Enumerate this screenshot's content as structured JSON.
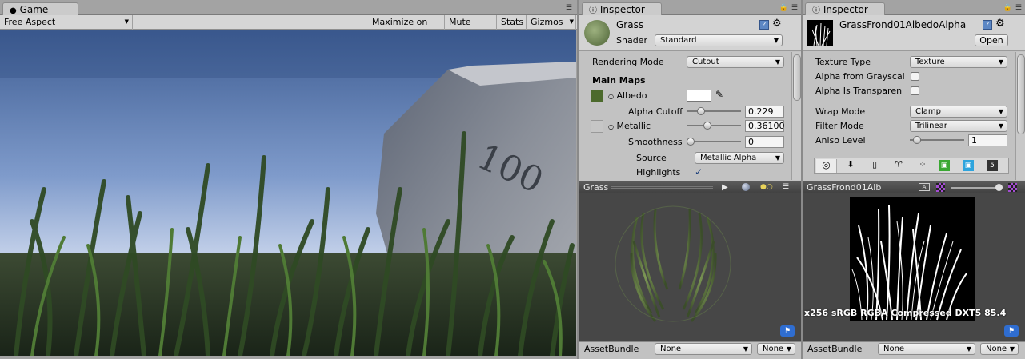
{
  "game": {
    "tab": "Game",
    "aspect": "Free Aspect",
    "buttons": [
      "Maximize on Play",
      "Mute audio",
      "Stats",
      "Gizmos"
    ],
    "scene_text": "100"
  },
  "inspector1": {
    "tab": "Inspector",
    "asset_name": "Grass",
    "shader_label": "Shader",
    "shader_value": "Standard",
    "rendering_mode_label": "Rendering Mode",
    "rendering_mode_value": "Cutout",
    "main_maps": "Main Maps",
    "albedo": "Albedo",
    "alpha_cutoff_label": "Alpha Cutoff",
    "alpha_cutoff_value": "0.229",
    "alpha_cutoff_fraction": 0.229,
    "metallic_label": "Metallic",
    "metallic_value": "0.36100",
    "metallic_fraction": 0.361,
    "smoothness_label": "Smoothness",
    "smoothness_value": "0",
    "smoothness_fraction": 0,
    "source_label": "Source",
    "source_value": "Metallic Alpha",
    "highlights_label": "Highlights",
    "highlights_checked": true,
    "preview_title": "Grass",
    "assetbundle_label": "AssetBundle",
    "assetbundle_value": "None",
    "assetbundle_variant": "None"
  },
  "inspector2": {
    "tab": "Inspector",
    "asset_name": "GrassFrond01AlbedoAlpha",
    "open_button": "Open",
    "texture_type_label": "Texture Type",
    "texture_type_value": "Texture",
    "alpha_from_grayscale_label": "Alpha from Grayscal",
    "alpha_is_transparency_label": "Alpha Is Transparen",
    "wrap_mode_label": "Wrap Mode",
    "wrap_mode_value": "Clamp",
    "filter_mode_label": "Filter Mode",
    "filter_mode_value": "Trilinear",
    "aniso_label": "Aniso Level",
    "aniso_value": "1",
    "aniso_fraction": 0.0625,
    "platform_icons": [
      "globe-icon",
      "download-icon",
      "phone-icon",
      "android-icon",
      "blackberry-icon",
      "windows-store-icon",
      "windows-phone-icon",
      "html5-icon"
    ],
    "preview_title": "GrassFrond01Alb",
    "preview_info": "x256 sRGB RGBA Compressed DXT5   85.4",
    "assetbundle_label": "AssetBundle",
    "assetbundle_value": "None",
    "assetbundle_variant": "None"
  }
}
